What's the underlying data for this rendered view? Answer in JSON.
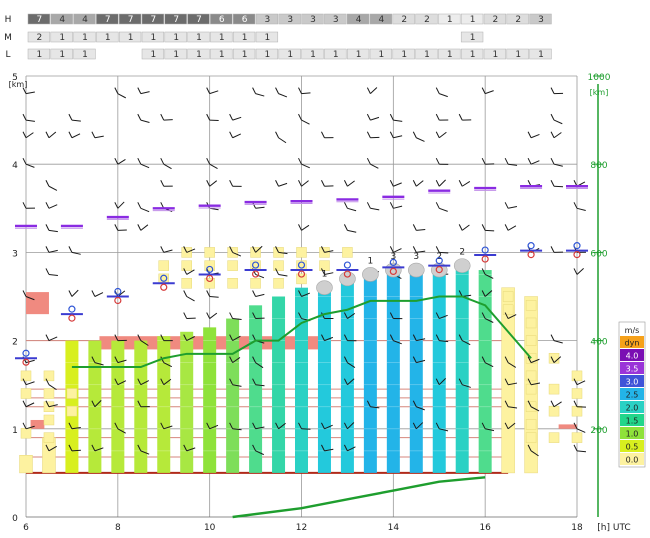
{
  "chart_data": {
    "type": "meteogram",
    "x_unit": "[h] UTC",
    "x_ticks": [
      6,
      8,
      10,
      12,
      14,
      16,
      18
    ],
    "y_left_unit": "[km]",
    "y_left_ticks": [
      0,
      1,
      2,
      3,
      4,
      5
    ],
    "y_right_unit": "[km]",
    "y_right_ticks": [
      200,
      400,
      600,
      800,
      1000
    ],
    "grid": true,
    "cloud_rows": {
      "labels": [
        "H",
        "M",
        "L"
      ],
      "H": [
        "7",
        "4",
        "4",
        "7",
        "7",
        "7",
        "7",
        "7",
        "6",
        "6",
        "3",
        "3",
        "3",
        "3",
        "4",
        "4",
        "2",
        "2",
        "1",
        "1",
        "2",
        "2",
        "3"
      ],
      "M": [
        "2",
        "1",
        "1",
        "1",
        "1",
        "1",
        "1",
        "1",
        "1",
        "1",
        "1",
        "",
        "",
        "",
        "",
        "",
        "",
        "",
        "",
        "1",
        "",
        "",
        ""
      ],
      "L": [
        "1",
        "1",
        "1",
        "",
        "",
        "1",
        "1",
        "1",
        "1",
        "1",
        "1",
        "1",
        "1",
        "1",
        "1",
        "1",
        "1",
        "1",
        "1",
        "1",
        "1",
        "1",
        "1"
      ]
    },
    "legend": {
      "title": "m/s",
      "items": [
        {
          "label": "dyn",
          "color": "#f6a11a"
        },
        {
          "label": "4.0",
          "color": "#7a0fb3"
        },
        {
          "label": "3.5",
          "color": "#9a34d8"
        },
        {
          "label": "3.0",
          "color": "#3f53d8"
        },
        {
          "label": "2.5",
          "color": "#23b4e8"
        },
        {
          "label": "2.0",
          "color": "#2ad1c4"
        },
        {
          "label": "1.5",
          "color": "#22d68b"
        },
        {
          "label": "1.0",
          "color": "#8fe23a"
        },
        {
          "label": "0.5",
          "color": "#d8ef1f"
        },
        {
          "label": "0.0",
          "color": "#fdf2a0"
        }
      ]
    },
    "thermal_columns": [
      {
        "t": 6.0,
        "top": 0.7,
        "type": "low"
      },
      {
        "t": 6.5,
        "top": 0.9,
        "type": "low"
      },
      {
        "t": 7.0,
        "top": 2.0,
        "type": "tall",
        "color": "#d8ef1f"
      },
      {
        "t": 7.5,
        "top": 2.0,
        "type": "tall",
        "color": "#b6e93a"
      },
      {
        "t": 8.0,
        "top": 2.0,
        "type": "tall",
        "color": "#b6e93a"
      },
      {
        "t": 8.5,
        "top": 2.0,
        "type": "tall",
        "color": "#b6e93a"
      },
      {
        "t": 9.0,
        "top": 2.05,
        "type": "tall",
        "color": "#b6e93a"
      },
      {
        "t": 9.5,
        "top": 2.1,
        "type": "tall",
        "color": "#a8e743"
      },
      {
        "t": 10.0,
        "top": 2.15,
        "type": "tall",
        "color": "#8fe23a"
      },
      {
        "t": 10.5,
        "top": 2.25,
        "type": "tall",
        "color": "#7ede5a"
      },
      {
        "t": 11.0,
        "top": 2.4,
        "type": "tall",
        "color": "#4fdc8d"
      },
      {
        "t": 11.5,
        "top": 2.5,
        "type": "tall",
        "color": "#33d6a8"
      },
      {
        "t": 12.0,
        "top": 2.6,
        "type": "tall",
        "color": "#2ad1c4"
      },
      {
        "t": 12.5,
        "top": 2.55,
        "type": "tall",
        "color": "#23c9dc"
      },
      {
        "t": 13.0,
        "top": 2.75,
        "type": "tall",
        "color": "#23c9dc"
      },
      {
        "t": 13.5,
        "top": 2.8,
        "type": "tall",
        "color": "#23b4e8"
      },
      {
        "t": 14.0,
        "top": 2.85,
        "type": "tall",
        "color": "#23b4e8"
      },
      {
        "t": 14.5,
        "top": 2.85,
        "type": "tall",
        "color": "#23b4e8"
      },
      {
        "t": 15.0,
        "top": 2.8,
        "type": "tall",
        "color": "#23c9dc"
      },
      {
        "t": 15.5,
        "top": 2.8,
        "type": "tall",
        "color": "#2ad1c4"
      },
      {
        "t": 16.0,
        "top": 2.8,
        "type": "tall",
        "color": "#4fdc8d"
      },
      {
        "t": 16.5,
        "top": 2.6,
        "type": "low"
      },
      {
        "t": 17.0,
        "top": 2.5,
        "type": "low"
      }
    ],
    "cumulus_clouds": [
      {
        "t": 12.5,
        "base": 2.6,
        "label": "1"
      },
      {
        "t": 13.0,
        "base": 2.7,
        "label": ""
      },
      {
        "t": 13.5,
        "base": 2.75,
        "label": "1"
      },
      {
        "t": 14.0,
        "base": 2.8,
        "label": "3"
      },
      {
        "t": 14.5,
        "base": 2.8,
        "label": "3"
      },
      {
        "t": 15.0,
        "base": 2.8,
        "label": "2"
      },
      {
        "t": 15.5,
        "base": 2.85,
        "label": "2"
      }
    ],
    "cloud_base_markers": [
      {
        "t": 6.0,
        "y": 1.8
      },
      {
        "t": 7.0,
        "y": 2.3
      },
      {
        "t": 8.0,
        "y": 2.5
      },
      {
        "t": 9.0,
        "y": 2.65
      },
      {
        "t": 10.0,
        "y": 2.75
      },
      {
        "t": 11.0,
        "y": 2.8
      },
      {
        "t": 12.0,
        "y": 2.8
      },
      {
        "t": 13.0,
        "y": 2.8
      },
      {
        "t": 14.0,
        "y": 2.83
      },
      {
        "t": 15.0,
        "y": 2.85
      },
      {
        "t": 16.0,
        "y": 2.97
      },
      {
        "t": 17.0,
        "y": 3.02
      },
      {
        "t": 18.0,
        "y": 3.02
      }
    ],
    "purple_markers": [
      {
        "t": 6.0,
        "y": 3.3
      },
      {
        "t": 7.0,
        "y": 3.3
      },
      {
        "t": 8.0,
        "y": 3.4
      },
      {
        "t": 9.0,
        "y": 3.5
      },
      {
        "t": 10.0,
        "y": 3.53
      },
      {
        "t": 11.0,
        "y": 3.57
      },
      {
        "t": 12.0,
        "y": 3.58
      },
      {
        "t": 13.0,
        "y": 3.6
      },
      {
        "t": 14.0,
        "y": 3.63
      },
      {
        "t": 15.0,
        "y": 3.7
      },
      {
        "t": 16.0,
        "y": 3.73
      },
      {
        "t": 17.0,
        "y": 3.75
      },
      {
        "t": 18.0,
        "y": 3.75
      }
    ],
    "boundary_layer_line": [
      [
        7,
        1.7
      ],
      [
        8,
        1.7
      ],
      [
        8.5,
        1.7
      ],
      [
        9,
        1.8
      ],
      [
        9.5,
        1.85
      ],
      [
        10,
        1.85
      ],
      [
        10.5,
        1.85
      ],
      [
        11,
        2.0
      ],
      [
        11.5,
        2.0
      ],
      [
        12,
        2.2
      ],
      [
        12.5,
        2.3
      ],
      [
        13,
        2.35
      ],
      [
        13.5,
        2.45
      ],
      [
        14,
        2.45
      ],
      [
        14.5,
        2.45
      ],
      [
        15,
        2.5
      ],
      [
        15.5,
        2.5
      ],
      [
        16,
        2.4
      ],
      [
        16.5,
        2.1
      ],
      [
        17,
        1.8
      ]
    ],
    "right_axis_line": [
      [
        10.5,
        0.0
      ],
      [
        12,
        0.1
      ],
      [
        13,
        0.2
      ],
      [
        14,
        0.3
      ],
      [
        15,
        0.4
      ],
      [
        16,
        0.45
      ]
    ],
    "inversion_lines": [
      0.5,
      0.68,
      0.9,
      1.25,
      1.35,
      1.45,
      2.0
    ],
    "red_blocks": [
      {
        "t0": 6.0,
        "t1": 6.5,
        "y0": 2.3,
        "y1": 2.55
      },
      {
        "t0": 6.1,
        "t1": 6.4,
        "y0": 1.0,
        "y1": 1.1
      },
      {
        "t0": 7.6,
        "t1": 12.5,
        "y0": 1.9,
        "y1": 2.05
      },
      {
        "t0": 17.6,
        "t1": 18.0,
        "y0": 1.0,
        "y1": 1.05
      }
    ]
  }
}
